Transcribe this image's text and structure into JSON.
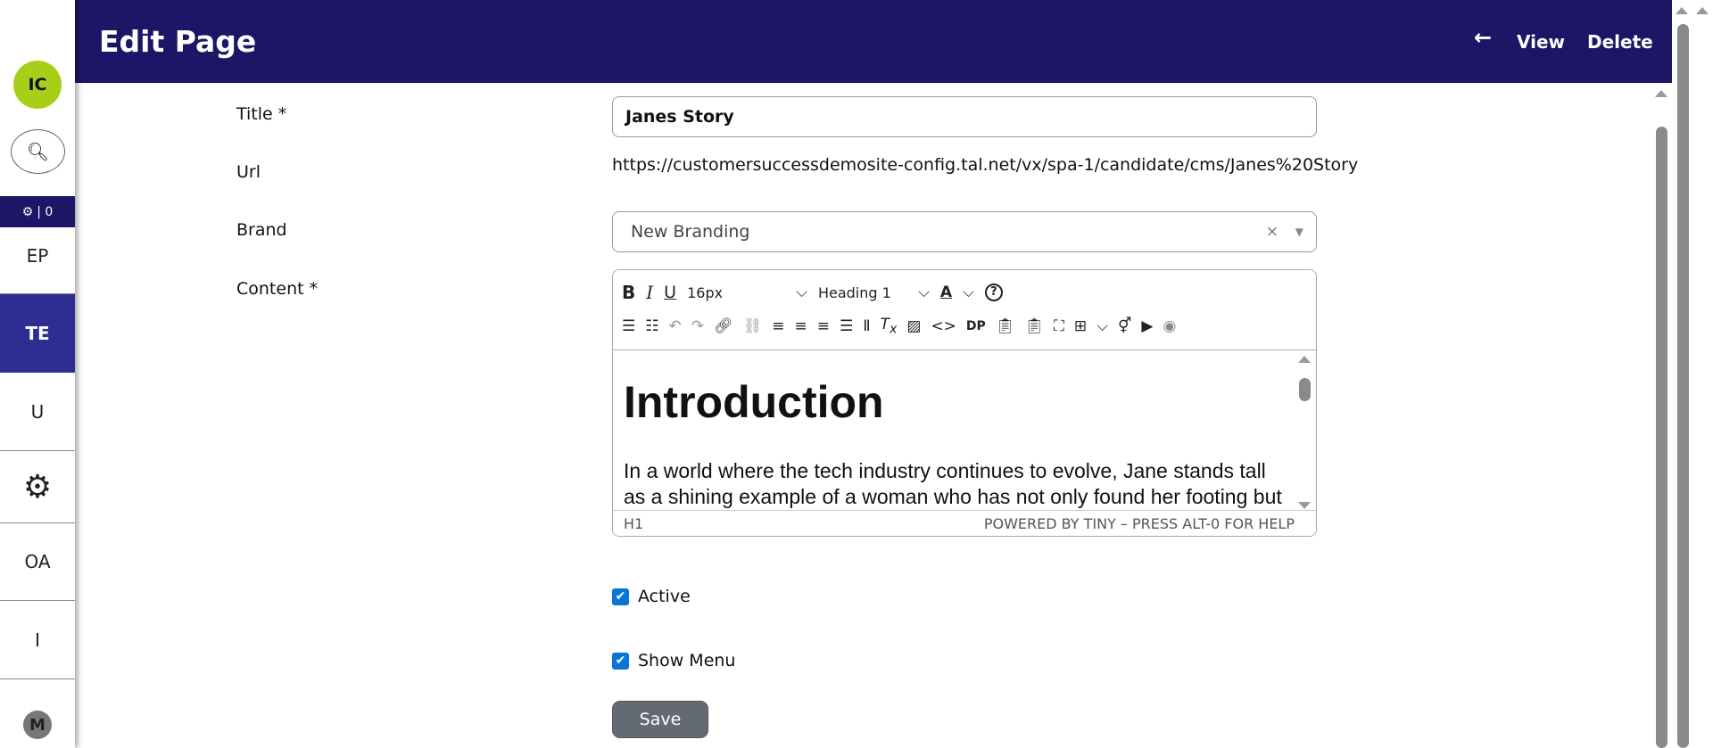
{
  "sidebar": {
    "avatar": "IC",
    "badge": "| 0",
    "items": [
      "EP",
      "TE",
      "U",
      "OA",
      "I"
    ],
    "bottom": "M"
  },
  "header": {
    "title": "Edit Page",
    "view": "View",
    "delete": "Delete"
  },
  "form": {
    "title_label": "Title *",
    "title_value": "Janes Story",
    "url_label": "Url",
    "url_value": "https://customersuccessdemosite-config.tal.net/vx/spa-1/candidate/cms/Janes%20Story",
    "brand_label": "Brand",
    "brand_value": "New Branding",
    "content_label": "Content *",
    "active_label": "Active",
    "show_menu_label": "Show Menu",
    "save": "Save"
  },
  "editor": {
    "font_size": "16px",
    "block_format": "Heading 1",
    "dp": "DP",
    "heading": "Introduction",
    "paragraph": "In a world where the tech industry continues to evolve, Jane stands tall as a shining example of a woman who has not only found her footing but thrived as a Data Analyst. Her journey is one of",
    "path": "H1",
    "branding": "POWERED BY TINY – PRESS ALT-0 FOR HELP"
  }
}
